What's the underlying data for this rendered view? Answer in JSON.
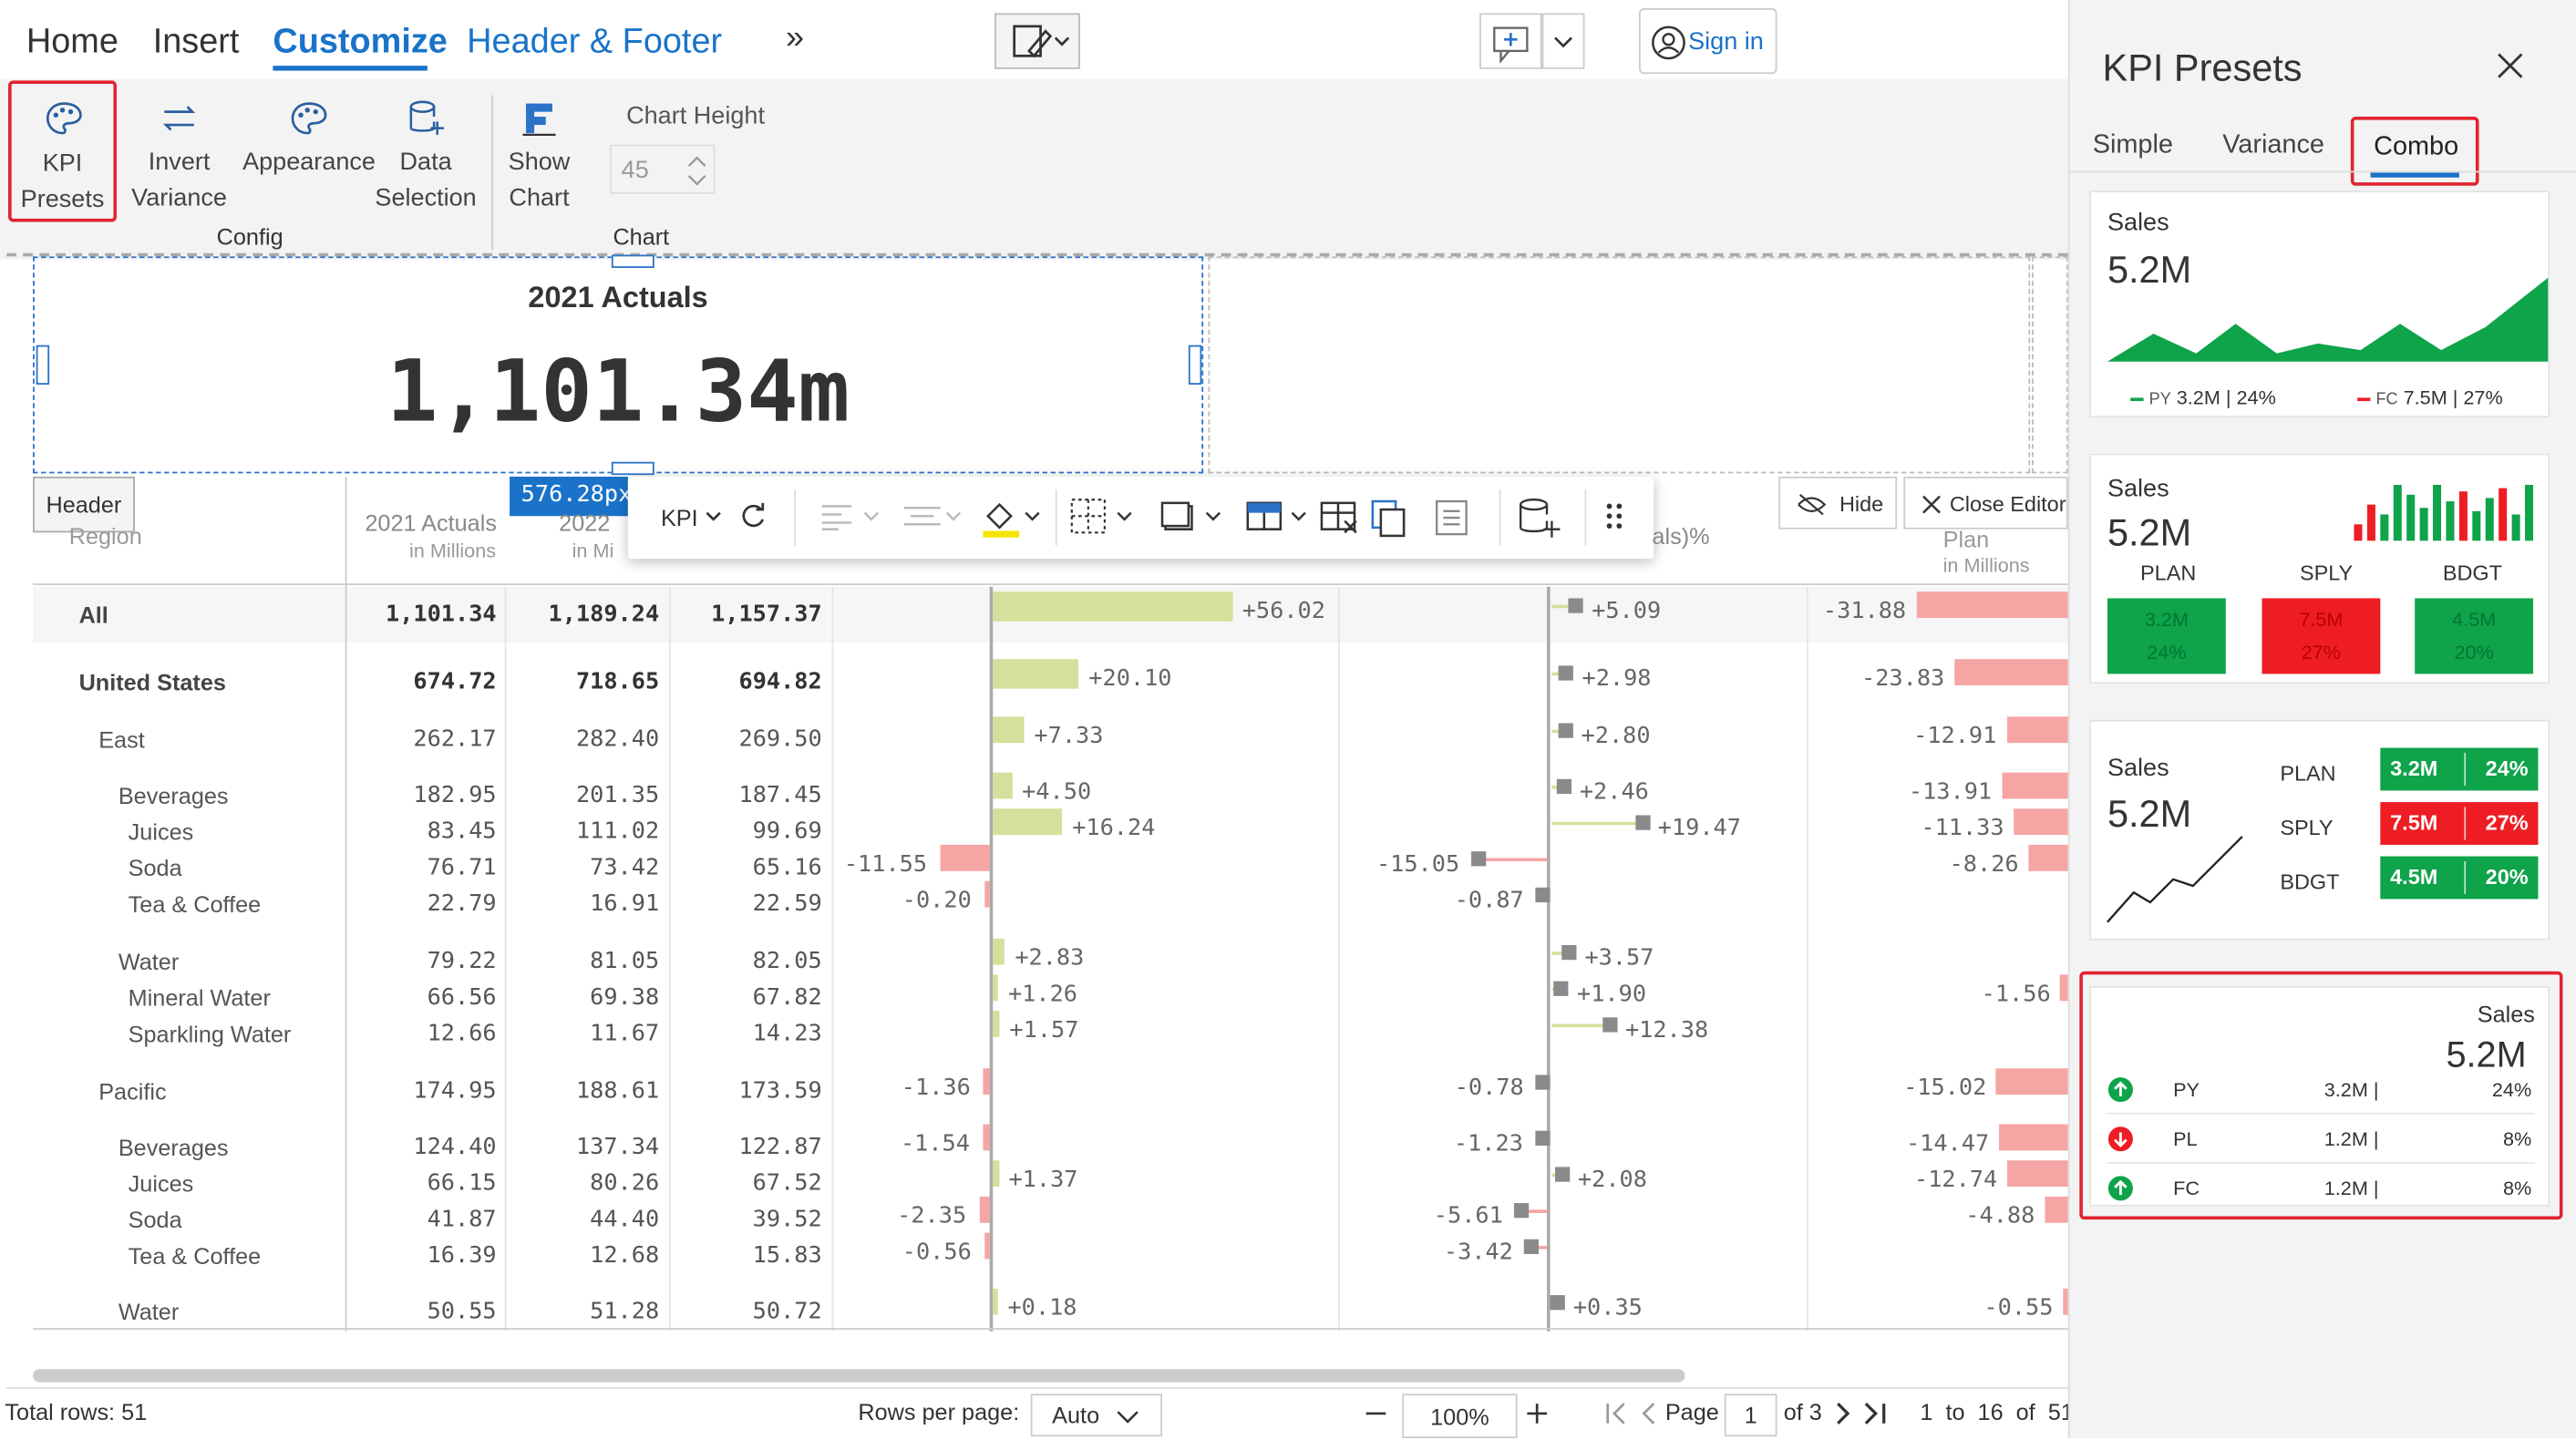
{
  "ribbon": {
    "tabs": [
      "Home",
      "Insert",
      "Customize",
      "Header & Footer"
    ],
    "more": "»",
    "sign_in": "Sign in",
    "buttons": {
      "kpi_presets": [
        "KPI",
        "Presets"
      ],
      "invert_variance": [
        "Invert",
        "Variance"
      ],
      "appearance": "Appearance",
      "data_selection": [
        "Data",
        "Selection"
      ],
      "show_chart": [
        "Show",
        "Chart"
      ]
    },
    "chart_height_label": "Chart Height",
    "chart_height_value": "45",
    "group_config": "Config",
    "group_chart": "Chart"
  },
  "kpi_header": {
    "title": "2021 Actuals",
    "value": "1,101.34m"
  },
  "width_badge": "576.28px",
  "header_tag": "Header",
  "toolbar": {
    "kpi_label": "KPI"
  },
  "editor": {
    "hide": "Hide",
    "close": "Close Editor"
  },
  "columns": {
    "region": "Region",
    "actuals2021": "2021 Actuals",
    "in_millions": "in Millions",
    "col2022": "2022",
    "in_mi": "in Mi",
    "variance_pct": "als)%",
    "plan": "Plan"
  },
  "rows": [
    {
      "label": "All",
      "a": "1,101.34",
      "b": "1,189.24",
      "c": "1,157.37",
      "v1": "+56.02",
      "v2": "+5.09",
      "v3": "-31.88"
    },
    {
      "label": "United States",
      "a": "674.72",
      "b": "718.65",
      "c": "694.82",
      "v1": "+20.10",
      "v2": "+2.98",
      "v3": "-23.83"
    },
    {
      "label": "East",
      "a": "262.17",
      "b": "282.40",
      "c": "269.50",
      "v1": "+7.33",
      "v2": "+2.80",
      "v3": "-12.91"
    },
    {
      "label": "Beverages",
      "a": "182.95",
      "b": "201.35",
      "c": "187.45",
      "v1": "+4.50",
      "v2": "+2.46",
      "v3": "-13.91"
    },
    {
      "label": "Juices",
      "a": "83.45",
      "b": "111.02",
      "c": "99.69",
      "v1": "+16.24",
      "v2": "+19.47",
      "v3": "-11.33"
    },
    {
      "label": "Soda",
      "a": "76.71",
      "b": "73.42",
      "c": "65.16",
      "v0": "-11.55",
      "v2": "-15.05",
      "v3": "-8.26"
    },
    {
      "label": "Tea & Coffee",
      "a": "22.79",
      "b": "16.91",
      "c": "22.59",
      "v0": "-0.20",
      "v2": "-0.87"
    },
    {
      "label": "Water",
      "a": "79.22",
      "b": "81.05",
      "c": "82.05",
      "v1": "+2.83",
      "v2": "+3.57"
    },
    {
      "label": "Mineral Water",
      "a": "66.56",
      "b": "69.38",
      "c": "67.82",
      "v1": "+1.26",
      "v2": "+1.90",
      "v3": "-1.56"
    },
    {
      "label": "Sparkling Water",
      "a": "12.66",
      "b": "11.67",
      "c": "14.23",
      "v1": "+1.57",
      "v2": "+12.38"
    },
    {
      "label": "Pacific",
      "a": "174.95",
      "b": "188.61",
      "c": "173.59",
      "v0": "-1.36",
      "v2": "-0.78",
      "v3": "-15.02"
    },
    {
      "label": "Beverages",
      "a": "124.40",
      "b": "137.34",
      "c": "122.87",
      "v0": "-1.54",
      "v2": "-1.23",
      "v3": "-14.47"
    },
    {
      "label": "Juices",
      "a": "66.15",
      "b": "80.26",
      "c": "67.52",
      "v1": "+1.37",
      "v2": "+2.08",
      "v3": "-12.74"
    },
    {
      "label": "Soda",
      "a": "41.87",
      "b": "44.40",
      "c": "39.52",
      "v0": "-2.35",
      "v2": "-5.61",
      "v3": "-4.88"
    },
    {
      "label": "Tea & Coffee",
      "a": "16.39",
      "b": "12.68",
      "c": "15.83",
      "v0": "-0.56",
      "v2": "-3.42"
    },
    {
      "label": "Water",
      "a": "50.55",
      "b": "51.28",
      "c": "50.72",
      "v1": "+0.18",
      "v2": "+0.35",
      "v3": "-0.55"
    }
  ],
  "footer": {
    "total_rows": "Total rows: 51",
    "rows_per_page": "Rows per page:",
    "rows_per_page_value": "Auto",
    "zoom": "100%",
    "page_label": "Page",
    "page_value": "1",
    "of_pages": "of 3",
    "range": "1  to  16  of  51"
  },
  "panel": {
    "title": "KPI Presets",
    "tabs": [
      "Simple",
      "Variance",
      "Combo"
    ],
    "card1": {
      "label": "Sales",
      "value": "5.2M",
      "py": "PY",
      "py_val": "3.2M | 24%",
      "fc": "FC",
      "fc_val": "7.5M | 27%"
    },
    "card2": {
      "label": "Sales",
      "value": "5.2M",
      "cols": [
        "PLAN",
        "SPLY",
        "BDGT"
      ],
      "tiles": [
        [
          "3.2M",
          "24%"
        ],
        [
          "7.5M",
          "27%"
        ],
        [
          "4.5M",
          "20%"
        ]
      ]
    },
    "card3": {
      "label": "Sales",
      "value": "5.2M",
      "rows": [
        [
          "PLAN",
          "3.2M",
          "24%"
        ],
        [
          "SPLY",
          "7.5M",
          "27%"
        ],
        [
          "BDGT",
          "4.5M",
          "20%"
        ]
      ]
    },
    "card4": {
      "label": "Sales",
      "value": "5.2M",
      "rows": [
        [
          "PY",
          "3.2M |",
          "24%"
        ],
        [
          "PL",
          "1.2M |",
          "8%"
        ],
        [
          "FC",
          "1.2M |",
          "8%"
        ]
      ]
    }
  },
  "colors": {
    "accent": "#1a73c9",
    "green": "#0fa34a",
    "red": "#ee1d24",
    "highlight": "#e0242f"
  }
}
